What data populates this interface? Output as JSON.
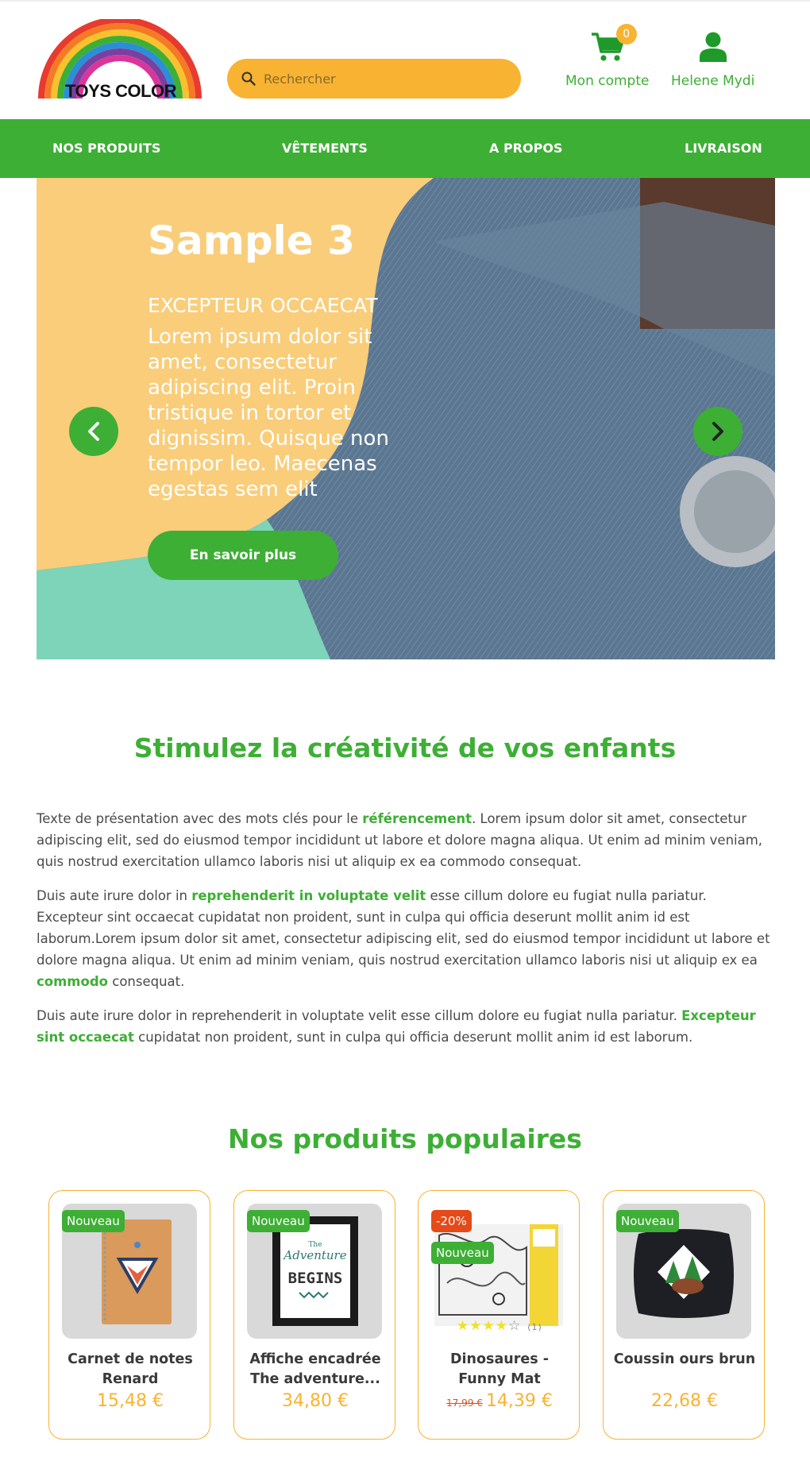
{
  "brand": {
    "logo_text": "TOYS COLOR"
  },
  "search": {
    "placeholder": "Rechercher"
  },
  "header": {
    "cart_count": "0",
    "account_label": "Mon compte",
    "user_label": "Helene Mydi"
  },
  "nav": {
    "items": [
      {
        "label": "NOS PRODUITS"
      },
      {
        "label": "VÊTEMENTS"
      },
      {
        "label": "A PROPOS"
      },
      {
        "label": "LIVRAISON"
      }
    ]
  },
  "hero": {
    "title": "Sample 3",
    "subtitle": "EXCEPTEUR OCCAECAT",
    "body": "Lorem ipsum dolor sit amet, consectetur adipiscing elit. Proin tristique in tortor et dignissim. Quisque non tempor leo. Maecenas egestas sem elit",
    "button": "En savoir plus"
  },
  "intro": {
    "title": "Stimulez la créativité de vos enfants",
    "p1_a": "Texte de présentation avec des mots clés pour le ",
    "p1_b": "référencement",
    "p1_c": ". Lorem ipsum dolor sit amet, consectetur adipiscing elit, sed do eiusmod tempor incididunt ut labore et dolore magna aliqua. Ut enim ad minim veniam, quis nostrud exercitation ullamco laboris nisi ut aliquip ex ea commodo consequat.",
    "p2_a": "Duis aute irure dolor in ",
    "p2_b": "reprehenderit in voluptate velit",
    "p2_c": " esse cillum dolore eu fugiat nulla pariatur. Excepteur sint occaecat cupidatat non proident, sunt in culpa qui officia deserunt mollit anim id est laborum.Lorem ipsum dolor sit amet, consectetur adipiscing elit, sed do eiusmod tempor incididunt ut labore et dolore magna aliqua. Ut enim ad minim veniam, quis nostrud exercitation ullamco laboris nisi ut aliquip ex ea ",
    "p2_d": "commodo",
    "p2_e": " consequat.",
    "p3_a": "Duis aute irure dolor in reprehenderit in voluptate velit esse cillum dolore eu fugiat nulla pariatur. ",
    "p3_b": "Excepteur sint occaecat",
    "p3_c": " cupidatat non proident, sunt in culpa qui officia deserunt mollit anim id est laborum."
  },
  "products": {
    "title": "Nos produits populaires",
    "items": [
      {
        "badge": "Nouveau",
        "name": "Carnet de notes Renard",
        "price": "15,48 €"
      },
      {
        "badge": "Nouveau",
        "name": "Affiche encadrée The adventure...",
        "price": "34,80 €",
        "poster_line1": "The",
        "poster_line2": "Adventure",
        "poster_line3": "BEGINS"
      },
      {
        "badge": "Nouveau",
        "discount": "-20%",
        "name": "Dinosaures - Funny Mat",
        "old_price": "17,99 €",
        "price": "14,39 €",
        "rating": 4,
        "rating_count": "(1)",
        "stars_full": "★★★★",
        "stars_empty": "☆"
      },
      {
        "badge": "Nouveau",
        "name": "Coussin ours brun",
        "price": "22,68 €"
      }
    ]
  },
  "colors": {
    "green": "#3daf35",
    "orange": "#f8b332",
    "sale": "#e64a19"
  }
}
